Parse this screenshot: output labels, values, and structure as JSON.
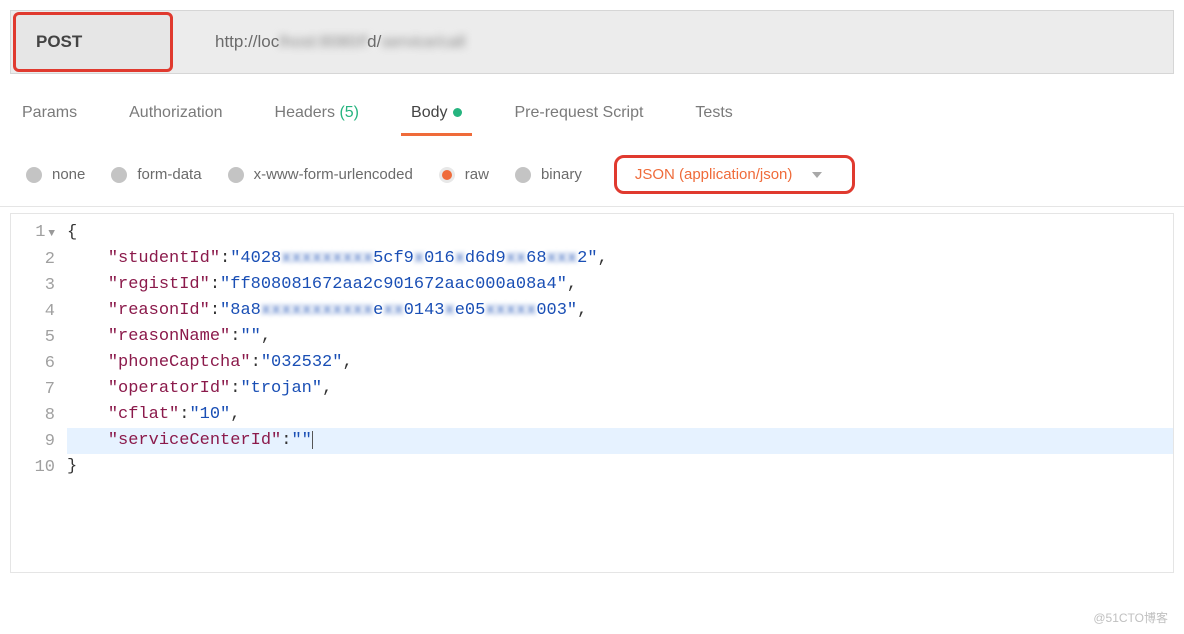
{
  "request": {
    "method": "POST",
    "url_prefix": "http://loc",
    "url_blurred_mid": "lhost:8080/f",
    "url_mid": "d/",
    "url_blurred_end": "service/call"
  },
  "tabs": {
    "params": "Params",
    "auth": "Authorization",
    "headers_label": "Headers",
    "headers_count": "(5)",
    "body": "Body",
    "prerequest": "Pre-request Script",
    "tests": "Tests"
  },
  "body_types": {
    "none": "none",
    "formdata": "form-data",
    "urlencoded": "x-www-form-urlencoded",
    "raw": "raw",
    "binary": "binary",
    "content_type": "JSON (application/json)"
  },
  "code": {
    "lines": [
      "1",
      "2",
      "3",
      "4",
      "5",
      "6",
      "7",
      "8",
      "9",
      "10"
    ],
    "l1": "{",
    "l2": {
      "key": "\"studentId\"",
      "val_a": "\"4028",
      "val_b": "xxxxxxxxx",
      "val_c": "5cf9",
      "val_d": "x",
      "val_e": "016",
      "val_f": "x",
      "val_g": "d6d9",
      "val_h": "xx",
      "val_i": "68",
      "val_j": "xxx",
      "val_k": "2\""
    },
    "l3": {
      "key": "\"registId\"",
      "val": "\"ff808081672aa2c901672aac000a08a4\""
    },
    "l4": {
      "key": "\"reasonId\"",
      "val_a": "\"8a8",
      "val_b": "xxxxxxxxxxx",
      "val_c": "e",
      "val_d": "xx",
      "val_e": "0143",
      "val_f": "x",
      "val_g": "e05",
      "val_h": "xxxxx",
      "val_i": "003\""
    },
    "l5": {
      "key": "\"reasonName\"",
      "val": "\"\""
    },
    "l6": {
      "key": "\"phoneCaptcha\"",
      "val": "\"032532\""
    },
    "l7": {
      "key": "\"operatorId\"",
      "val": "\"trojan\""
    },
    "l8": {
      "key": "\"cflat\"",
      "val": "\"10\""
    },
    "l9": {
      "key": "\"serviceCenterId\"",
      "val": "\"\""
    },
    "l10": "}"
  },
  "watermark": "@51CTO博客"
}
